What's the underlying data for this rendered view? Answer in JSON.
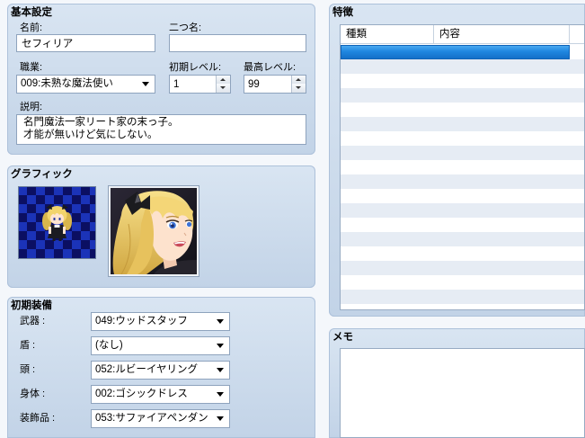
{
  "basic": {
    "title": "基本設定",
    "name": {
      "label": "名前:",
      "value": "セフィリア"
    },
    "nickname": {
      "label": "二つ名:",
      "value": ""
    },
    "class": {
      "label": "職業:",
      "value": "009:未熟な魔法使い"
    },
    "initial_level": {
      "label": "初期レベル:",
      "value": "1"
    },
    "max_level": {
      "label": "最高レベル:",
      "value": "99"
    },
    "description": {
      "label": "説明:",
      "lines": [
        "名門魔法一家リート家の末っ子。",
        "才能が無いけど気にしない。"
      ]
    }
  },
  "graphics": {
    "title": "グラフィック",
    "character_icon": "chibi-actor-sprite",
    "face_icon": "actor-face-portrait"
  },
  "equipment": {
    "title": "初期装備",
    "slots": [
      {
        "label": "武器 :",
        "value": "049:ウッドスタッフ"
      },
      {
        "label": "盾 :",
        "value": "(なし)"
      },
      {
        "label": "頭 :",
        "value": "052:ルビーイヤリング"
      },
      {
        "label": "身体 :",
        "value": "002:ゴシックドレス"
      },
      {
        "label": "装飾品 :",
        "value": "053:サファイアペンダン"
      }
    ]
  },
  "traits": {
    "title": "特徴",
    "columns": [
      "種類",
      "内容"
    ],
    "rows": [
      {
        "type": "",
        "content": ""
      }
    ]
  },
  "memo": {
    "title": "メモ",
    "value": ""
  },
  "colors": {
    "panel": "#c9d8ea",
    "selection": "#1f86e0",
    "row_stripe": "#e6ecf4",
    "checker_dark": "#0b0f62",
    "checker_light": "#1b33b8"
  }
}
